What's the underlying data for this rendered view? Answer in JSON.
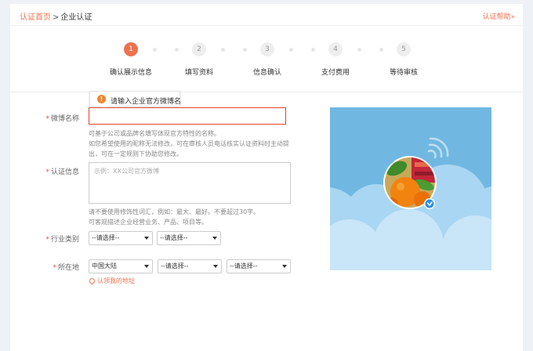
{
  "breadcrumb": {
    "home": "认证首页",
    "separator": ">",
    "current": "企业认证"
  },
  "help": "认证帮助»",
  "steps": [
    {
      "number": "1",
      "label": "确认展示信息",
      "active": true
    },
    {
      "number": "2",
      "label": "填写资料",
      "active": false
    },
    {
      "number": "3",
      "label": "信息确认",
      "active": false
    },
    {
      "number": "4",
      "label": "支付费用",
      "active": false
    },
    {
      "number": "5",
      "label": "等待审核",
      "active": false
    }
  ],
  "tooltip": {
    "icon": "warning-icon",
    "text": "请输入企业官方微博名"
  },
  "form": {
    "required_mark": "*",
    "weibo_name": {
      "label": "微博名称",
      "value": "",
      "hint1": "可基于公司或品牌名填写体现官方特性的名称。",
      "hint2": "如您希望使用的昵称无法修改，可在审核人员电话核实认证资料时主动提",
      "hint3": "出，可在一定规则下协助您修改。"
    },
    "auth_info": {
      "label": "认证信息",
      "placeholder": "示例：XX公司官方微博",
      "hint1": "请不要使用修饰性词汇，例如：最大、最好。不要超过30字。",
      "hint2": "可客观描述企业经营业务、产品、项目等。"
    },
    "industry": {
      "label": "行业类别",
      "select1": "--请选择--",
      "select2": "--请选择--"
    },
    "location": {
      "label": "所在地",
      "country": "中国大陆",
      "province": "--请选择--",
      "city": "--请选择--",
      "locate_link": "认领我的地址"
    }
  },
  "preview": {
    "verified_badge": "verified-check-icon"
  },
  "colors": {
    "accent": "#eb7350",
    "error": "#e0432f",
    "sky": "#70b8e2",
    "badge": "#2d8fe0"
  }
}
